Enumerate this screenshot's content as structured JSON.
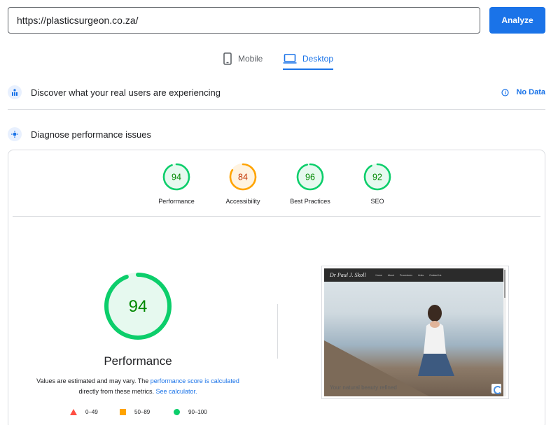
{
  "url_bar": {
    "value": "https://plasticsurgeon.co.za/",
    "analyze_label": "Analyze"
  },
  "tabs": [
    {
      "label": "Mobile",
      "icon": "phone-icon",
      "selected": false
    },
    {
      "label": "Desktop",
      "icon": "laptop-icon",
      "selected": true
    }
  ],
  "discover": {
    "title": "Discover what your real users are experiencing",
    "no_data": "No Data",
    "icon": "users-icon"
  },
  "diagnose": {
    "title": "Diagnose performance issues",
    "icon": "lighthouse-icon"
  },
  "scores": [
    {
      "label": "Performance",
      "value": 94,
      "status": "pass"
    },
    {
      "label": "Accessibility",
      "value": 84,
      "status": "average"
    },
    {
      "label": "Best Practices",
      "value": 96,
      "status": "pass"
    },
    {
      "label": "SEO",
      "value": 92,
      "status": "pass"
    }
  ],
  "performance": {
    "score": 94,
    "title": "Performance",
    "note_prefix": "Values are estimated and may vary. The",
    "note_link": "performance score is calculated",
    "note_middle": "directly from these metrics.",
    "note_link2": "See calculator."
  },
  "legend": [
    {
      "range": "0–49",
      "shape": "triangle",
      "color": "#ff4e42"
    },
    {
      "range": "50–89",
      "shape": "square",
      "color": "#ffa400"
    },
    {
      "range": "90–100",
      "shape": "circle",
      "color": "#0cce6b"
    }
  ],
  "screenshot": {
    "logo": "Dr Paul J. Skoll",
    "menu": [
      "Home",
      "About",
      "Procedures",
      "Links",
      "Contact Us"
    ],
    "tagline": "Your natural beauty refined"
  },
  "colors": {
    "accent": "#1a73e8",
    "pass": "#0cce6b",
    "pass_text": "#008800",
    "pass_bg": "#e6f9ef",
    "average": "#ffa400",
    "average_text": "#c33300",
    "average_bg": "#fff3e0",
    "fail": "#ff4e42"
  }
}
